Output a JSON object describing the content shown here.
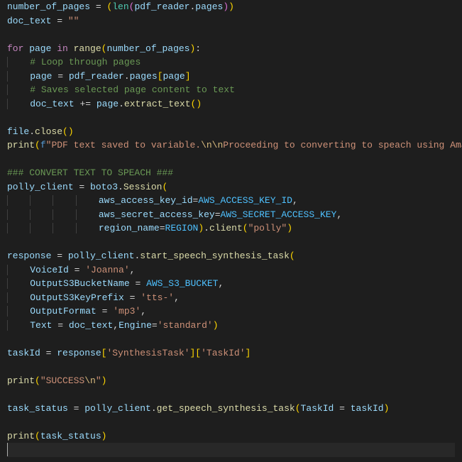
{
  "code": {
    "l01": {
      "v1": "number_of_pages",
      "op1": " = ",
      "par1": "(",
      "fn1": "len",
      "par2": "(",
      "v2": "pdf_reader",
      "dot": ".",
      "v3": "pages",
      "par3": ")",
      "par4": ")"
    },
    "l02": {
      "v1": "doc_text",
      "op1": " = ",
      "s1": "\"\""
    },
    "l04": {
      "kw1": "for",
      "v1": " page ",
      "kw2": "in",
      "fn1": " range",
      "par1": "(",
      "v2": "number_of_pages",
      "par2": ")",
      "colon": ":"
    },
    "l05": {
      "c1": "# Loop through pages"
    },
    "l06": {
      "v1": "page",
      "op1": " = ",
      "v2": "pdf_reader",
      "dot": ".",
      "v3": "pages",
      "br1": "[",
      "v4": "page",
      "br2": "]"
    },
    "l07": {
      "c1": "# Saves selected page content to text"
    },
    "l08": {
      "v1": "doc_text",
      "op1": " += ",
      "v2": "page",
      "dot": ".",
      "fn1": "extract_text",
      "par1": "(",
      "par2": ")"
    },
    "l10": {
      "v1": "file",
      "dot": ".",
      "fn1": "close",
      "par1": "(",
      "par2": ")"
    },
    "l11": {
      "fn1": "print",
      "par1": "(",
      "pre": "f",
      "s1": "\"PDF text saved to variable.",
      "esc1": "\\n\\n",
      "s2": "Proceeding to converting to speach using Ama"
    },
    "l13": {
      "c1": "### CONVERT TEXT TO SPEACH ###"
    },
    "l14": {
      "v1": "polly_client",
      "op1": " = ",
      "v2": "boto3",
      "dot": ".",
      "fn1": "Session",
      "par1": "("
    },
    "l15": {
      "v1": "aws_access_key_id",
      "op1": "=",
      "v2": "AWS_ACCESS_KEY_ID",
      "comma": ","
    },
    "l16": {
      "v1": "aws_secret_access_key",
      "op1": "=",
      "v2": "AWS_SECRET_ACCESS_KEY",
      "comma": ","
    },
    "l17": {
      "v1": "region_name",
      "op1": "=",
      "v2": "REGION",
      "par1": ")",
      "dot": ".",
      "fn1": "client",
      "par2": "(",
      "s1": "\"polly\"",
      "par3": ")"
    },
    "l19": {
      "v1": "response",
      "op1": " = ",
      "v2": "polly_client",
      "dot": ".",
      "fn1": "start_speech_synthesis_task",
      "par1": "("
    },
    "l20": {
      "v1": "VoiceId",
      "op1": " = ",
      "s1": "'Joanna'",
      "comma": ","
    },
    "l21": {
      "v1": "OutputS3BucketName",
      "op1": " = ",
      "v2": "AWS_S3_BUCKET",
      "comma": ","
    },
    "l22": {
      "v1": "OutputS3KeyPrefix",
      "op1": " = ",
      "s1": "'tts-'",
      "comma": ","
    },
    "l23": {
      "v1": "OutputFormat",
      "op1": " = ",
      "s1": "'mp3'",
      "comma": ","
    },
    "l24": {
      "v1": "Text",
      "op1": " = ",
      "v2": "doc_text",
      "comma": ",",
      "v3": "Engine",
      "op2": "=",
      "s1": "'standard'",
      "par1": ")"
    },
    "l26": {
      "v1": "taskId",
      "op1": " = ",
      "v2": "response",
      "br1": "[",
      "s1": "'SynthesisTask'",
      "br2": "]",
      "br3": "[",
      "s2": "'TaskId'",
      "br4": "]"
    },
    "l28": {
      "fn1": "print",
      "par1": "(",
      "s1": "\"SUCCESS",
      "esc": "\\n",
      "s2": "\"",
      "par2": ")"
    },
    "l30": {
      "v1": "task_status",
      "op1": " = ",
      "v2": "polly_client",
      "dot": ".",
      "fn1": "get_speech_synthesis_task",
      "par1": "(",
      "v3": "TaskId",
      "op2": " = ",
      "v4": "taskId",
      "par2": ")"
    },
    "l32": {
      "fn1": "print",
      "par1": "(",
      "v1": "task_status",
      "par2": ")"
    }
  }
}
